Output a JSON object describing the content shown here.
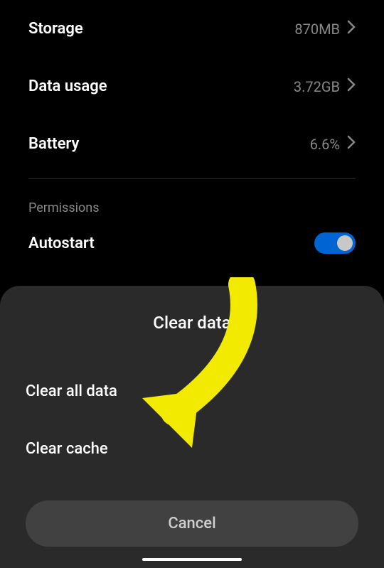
{
  "rows": {
    "storage": {
      "label": "Storage",
      "value": "870MB"
    },
    "data_usage": {
      "label": "Data usage",
      "value": "3.72GB"
    },
    "battery": {
      "label": "Battery",
      "value": "6.6%"
    }
  },
  "section": {
    "permissions": "Permissions",
    "autostart": "Autostart"
  },
  "sheet": {
    "title": "Clear data",
    "option_all": "Clear all data",
    "option_cache": "Clear cache",
    "cancel": "Cancel"
  }
}
